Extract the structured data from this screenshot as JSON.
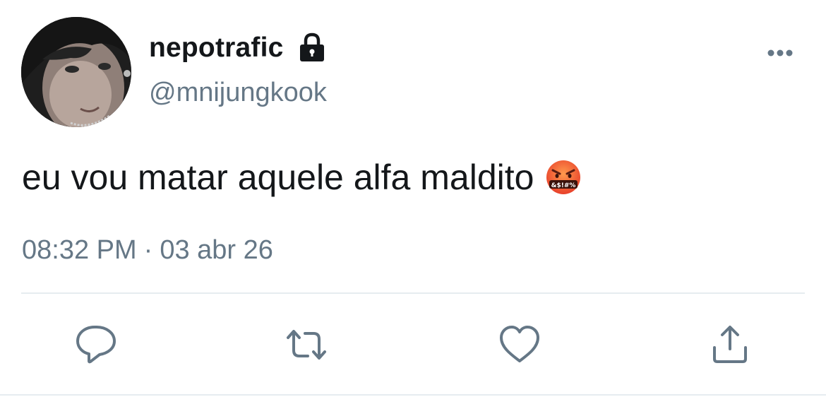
{
  "tweet": {
    "display_name": "nepotrafic",
    "handle": "@mnijungkook",
    "text": "eu vou matar aquele alfa maldito",
    "emoji_icon": "face-with-symbols-on-mouth-icon",
    "time": "08:32 PM",
    "separator": "·",
    "date": "03 abr 26",
    "protected_icon": "lock-icon"
  },
  "actions": [
    {
      "name": "reply",
      "icon": "speech-bubble-icon"
    },
    {
      "name": "retweet",
      "icon": "retweet-icon"
    },
    {
      "name": "like",
      "icon": "heart-icon"
    },
    {
      "name": "share",
      "icon": "share-icon"
    }
  ],
  "colors": {
    "text_primary": "#14171a",
    "text_secondary": "#657786",
    "divider": "#e6ecf0",
    "icon": "#657786"
  }
}
